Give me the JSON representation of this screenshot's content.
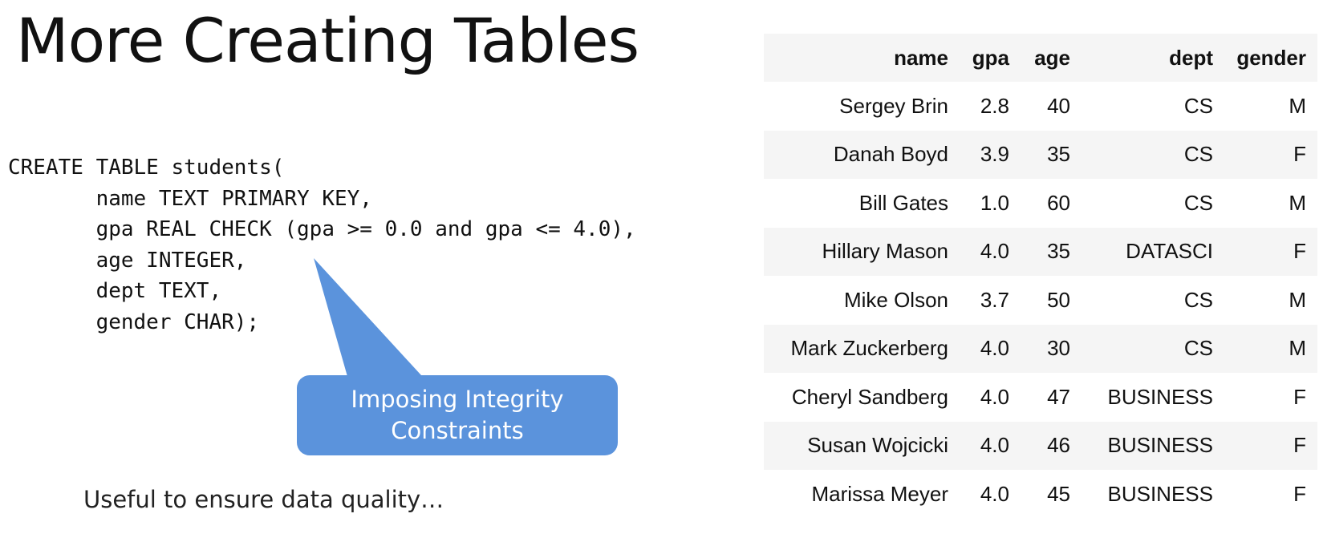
{
  "title": "More Creating Tables",
  "code": {
    "lines": [
      "CREATE TABLE students(",
      "       name TEXT PRIMARY KEY,",
      "       gpa REAL CHECK (gpa >= 0.0 and gpa <= 4.0),",
      "       age INTEGER,",
      "       dept TEXT,",
      "       gender CHAR);"
    ]
  },
  "callout": {
    "line1": "Imposing Integrity",
    "line2": "Constraints",
    "color": "#5b93dc"
  },
  "caption": "Useful to ensure data quality…",
  "table": {
    "headers": [
      "name",
      "gpa",
      "age",
      "dept",
      "gender"
    ],
    "rows": [
      [
        "Sergey Brin",
        "2.8",
        "40",
        "CS",
        "M"
      ],
      [
        "Danah Boyd",
        "3.9",
        "35",
        "CS",
        "F"
      ],
      [
        "Bill Gates",
        "1.0",
        "60",
        "CS",
        "M"
      ],
      [
        "Hillary Mason",
        "4.0",
        "35",
        "DATASCI",
        "F"
      ],
      [
        "Mike Olson",
        "3.7",
        "50",
        "CS",
        "M"
      ],
      [
        "Mark Zuckerberg",
        "4.0",
        "30",
        "CS",
        "M"
      ],
      [
        "Cheryl Sandberg",
        "4.0",
        "47",
        "BUSINESS",
        "F"
      ],
      [
        "Susan Wojcicki",
        "4.0",
        "46",
        "BUSINESS",
        "F"
      ],
      [
        "Marissa Meyer",
        "4.0",
        "45",
        "BUSINESS",
        "F"
      ]
    ]
  }
}
